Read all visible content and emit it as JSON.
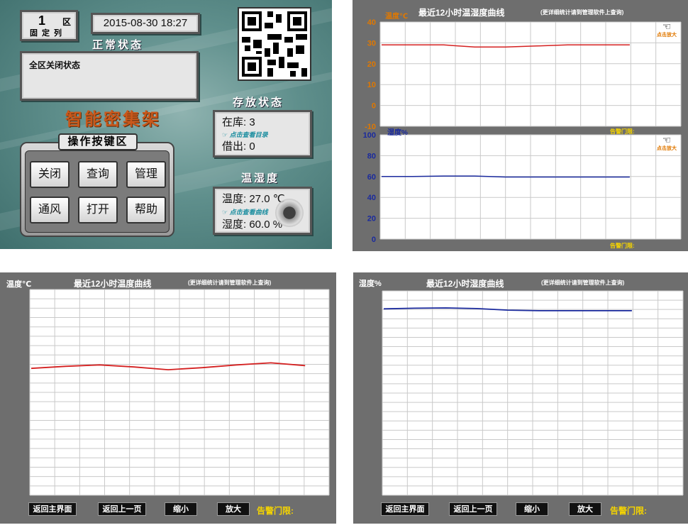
{
  "main_screen": {
    "zone_number": "1",
    "zone_unit": "区",
    "zone_type": "固定列",
    "datetime": "2015-08-30 18:27",
    "state_title": "正常状态",
    "state_message": "全区关闭状态",
    "brand": "智能密集架",
    "operations_title": "操作按键区",
    "buttons": [
      "关闭",
      "查询",
      "管理",
      "通风",
      "打开",
      "帮助"
    ],
    "storage": {
      "title": "存放状态",
      "in_stock_label": "在库:",
      "in_stock_value": "3",
      "hint": "点击查看目录",
      "lent_label": "借出:",
      "lent_value": "0"
    },
    "environment": {
      "title": "温湿度",
      "temp_label": "温度:",
      "temp_value": "27.0",
      "temp_unit": "℃",
      "hint": "点击查看曲线",
      "humidity_label": "湿度:",
      "humidity_value": "60.0",
      "humidity_unit": "%"
    },
    "icons": {
      "qr": "qr-code-icon",
      "knob": "knob-icon"
    }
  },
  "dual_chart": {
    "title": "最近12小时温湿度曲线",
    "note": "(更详细统计请到管理软件上查询)",
    "temp_axis_label": "温度℃",
    "humidity_axis_label": "湿度%",
    "zoom_hint": "点击放大",
    "alarm_label": "告警门限:"
  },
  "temp_screen": {
    "axis_label": "温度℃",
    "title": "最近12小时温度曲线",
    "note": "(更详细统计请到管理软件上查询)",
    "buttons": {
      "home": "返回主界面",
      "back": "返回上一页",
      "zoom_out": "缩小",
      "zoom_in": "放大"
    },
    "alarm_label": "告警门限:"
  },
  "humidity_screen": {
    "axis_label": "湿度%",
    "title": "最近12小时湿度曲线",
    "note": "(更详细统计请到管理软件上查询)",
    "buttons": {
      "home": "返回主界面",
      "back": "返回上一页",
      "zoom_out": "缩小",
      "zoom_in": "放大"
    },
    "alarm_label": "告警门限:"
  },
  "colors": {
    "temperature_line": "#d42020",
    "humidity_line": "#1a2a9e",
    "axis_label_temp": "#e07800",
    "axis_label_humidity": "#1a2a9e",
    "alarm": "#f5d400"
  },
  "chart_data": [
    {
      "type": "line",
      "title": "最近12小时温湿度曲线",
      "ylabel": "温度℃",
      "ylim": [
        -10,
        40
      ],
      "yticks": [
        40,
        30,
        20,
        10,
        0,
        -10
      ],
      "series": [
        {
          "name": "温度℃",
          "values": [
            29,
            29,
            29,
            28,
            28,
            28.5,
            29,
            29,
            29
          ]
        }
      ]
    },
    {
      "type": "line",
      "ylabel": "湿度%",
      "ylim": [
        0,
        100
      ],
      "yticks": [
        100,
        80,
        60,
        40,
        20,
        0
      ],
      "series": [
        {
          "name": "湿度%",
          "values": [
            60,
            60,
            60.5,
            60.5,
            59.5,
            59.5,
            59.5,
            59.5,
            59.5
          ]
        }
      ]
    },
    {
      "type": "line",
      "title": "最近12小时温度曲线",
      "ylabel": "温度℃",
      "series": [
        {
          "name": "温度℃",
          "values": [
            28.5,
            28.8,
            29,
            28.7,
            28.3,
            28.6,
            29,
            29.3,
            28.9
          ]
        }
      ]
    },
    {
      "type": "line",
      "title": "最近12小时湿度曲线",
      "ylabel": "湿度%",
      "series": [
        {
          "name": "湿度%",
          "values": [
            60.2,
            60.4,
            60.5,
            60.3,
            59.8,
            59.6,
            59.6,
            59.6,
            59.6
          ]
        }
      ]
    }
  ]
}
